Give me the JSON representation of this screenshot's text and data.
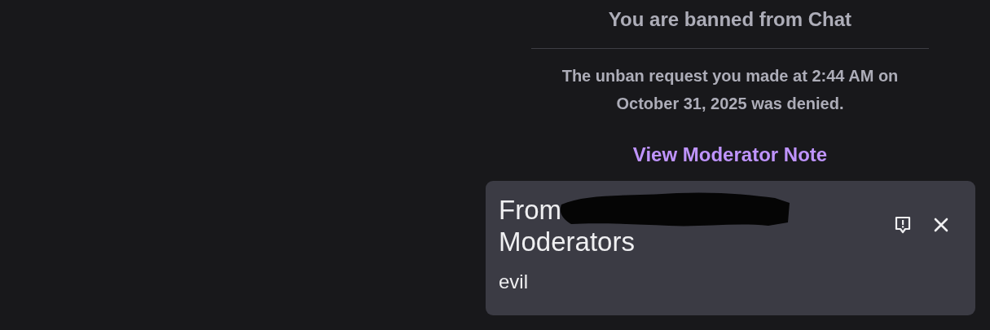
{
  "ban_notice": {
    "title": "You are banned from Chat",
    "message": "The unban request you made at 2:44 AM on October 31, 2025 was denied.",
    "link": "View Moderator Note"
  },
  "note_card": {
    "heading_start": "From",
    "heading_end": "Moderators",
    "note": "evil"
  }
}
